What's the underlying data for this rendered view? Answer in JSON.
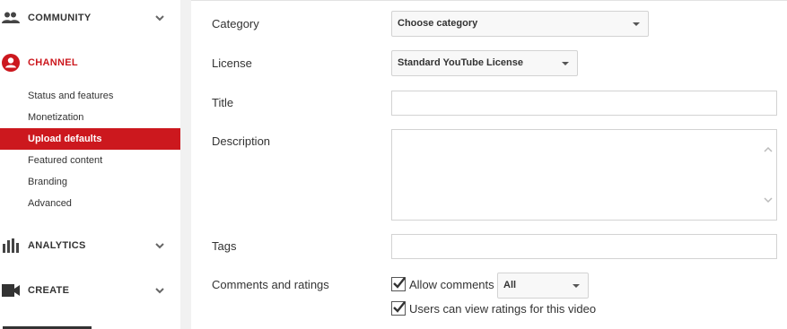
{
  "sidebar": {
    "sections": {
      "community": {
        "label": "COMMUNITY",
        "icon": "people-icon"
      },
      "channel": {
        "label": "CHANNEL",
        "icon": "account-circle-icon",
        "color": "#cc181e"
      },
      "analytics": {
        "label": "ANALYTICS",
        "icon": "bar-chart-icon"
      },
      "create": {
        "label": "CREATE",
        "icon": "video-camera-icon"
      }
    },
    "channel_items": [
      {
        "label": "Status and features"
      },
      {
        "label": "Monetization"
      },
      {
        "label": "Upload defaults",
        "selected": true
      },
      {
        "label": "Featured content"
      },
      {
        "label": "Branding"
      },
      {
        "label": "Advanced"
      }
    ]
  },
  "form": {
    "category": {
      "label": "Category",
      "value": "Choose category"
    },
    "license": {
      "label": "License",
      "value": "Standard YouTube License"
    },
    "title": {
      "label": "Title",
      "value": ""
    },
    "description": {
      "label": "Description",
      "value": ""
    },
    "tags": {
      "label": "Tags",
      "value": ""
    },
    "comments": {
      "label": "Comments and ratings",
      "allow_comments": {
        "label": "Allow comments",
        "checked": true,
        "select_value": "All"
      },
      "view_ratings": {
        "label": "Users can view ratings for this video",
        "checked": true
      }
    }
  },
  "colors": {
    "accent": "#cc181e"
  }
}
